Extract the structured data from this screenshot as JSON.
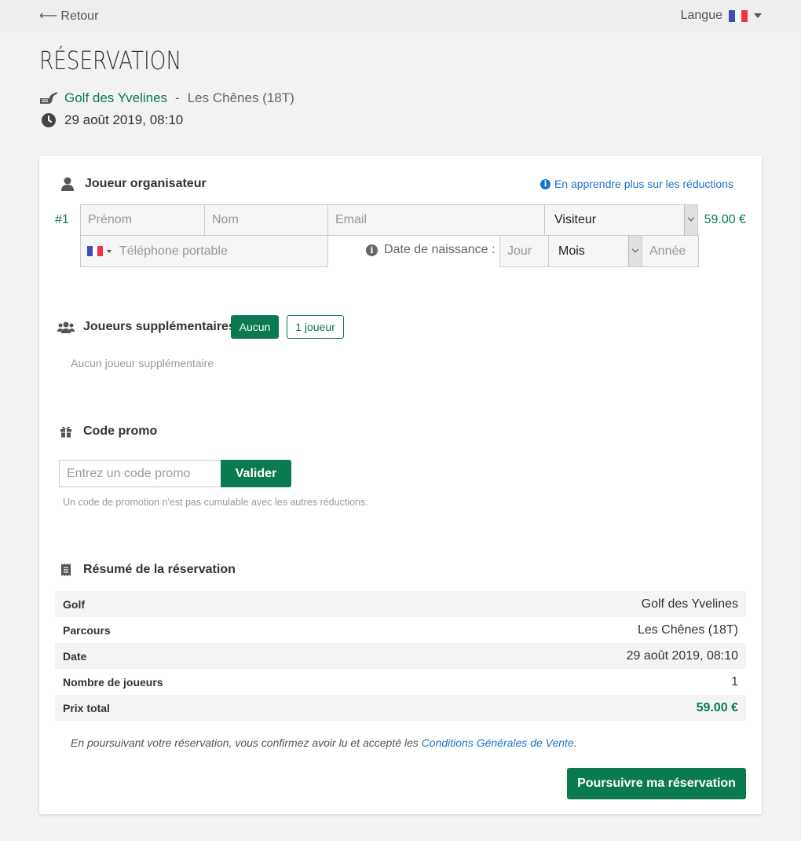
{
  "topbar": {
    "back_label": "⟵ Retour",
    "language_label": "Langue"
  },
  "page": {
    "title": "RÉSERVATION"
  },
  "header": {
    "golf_name": "Golf des Yvelines",
    "separator": "-",
    "course_name": "Les Chênes (18T)",
    "datetime": "29 août 2019, 08:10"
  },
  "organizer": {
    "heading": "Joueur organisateur",
    "info_link": "En apprendre plus sur les réductions",
    "player_number": "#1",
    "firstname_placeholder": "Prénom",
    "lastname_placeholder": "Nom",
    "email_placeholder": "Email",
    "player_type": "Visiteur",
    "price": "59.00 €",
    "phone_placeholder": "Téléphone portable",
    "dob_label": "Date de naissance :",
    "day_placeholder": "Jour",
    "month_value": "Mois",
    "year_placeholder": "Année"
  },
  "extra_players": {
    "heading": "Joueurs supplémentaires",
    "option_none": "Aucun",
    "option_one": "1 joueur",
    "empty_text": "Aucun joueur supplémentaire"
  },
  "promo": {
    "heading": "Code promo",
    "placeholder": "Entrez un code promo",
    "submit_label": "Valider",
    "note": "Un code de promotion n'est pas cumulable avec les autres réductions."
  },
  "summary": {
    "heading": "Résumé de la réservation",
    "rows": [
      {
        "label": "Golf",
        "value": "Golf des Yvelines"
      },
      {
        "label": "Parcours",
        "value": "Les Chênes (18T)"
      },
      {
        "label": "Date",
        "value": "29 août 2019, 08:10"
      },
      {
        "label": "Nombre de joueurs",
        "value": "1"
      },
      {
        "label": "Prix total",
        "value": "59.00 €"
      }
    ],
    "terms_prefix": "En poursuivant votre réservation, vous confirmez avoir lu et accepté les ",
    "terms_link": "Conditions Générales de Vente",
    "terms_suffix": ".",
    "continue_label": "Poursuivre ma réservation"
  },
  "colors": {
    "brand_green": "#0b7a50",
    "link_blue": "#1a73c8"
  },
  "icons": [
    "golf-club-icon",
    "clock-icon",
    "user-icon",
    "info-icon",
    "users-icon",
    "gift-icon",
    "receipt-icon",
    "flag-fr-icon"
  ]
}
